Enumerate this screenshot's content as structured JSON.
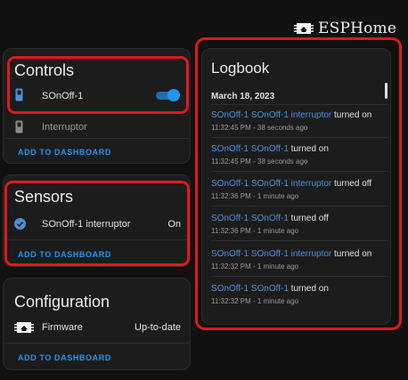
{
  "brand": {
    "name": "ESPHome",
    "icon": "esphome-chip-icon"
  },
  "controls": {
    "title": "Controls",
    "items": [
      {
        "label": "SOnOff-1",
        "icon": "switch-icon",
        "state": "on"
      },
      {
        "label": "Interruptor",
        "icon": "switch-icon"
      }
    ],
    "action": "ADD TO DASHBOARD"
  },
  "sensors": {
    "title": "Sensors",
    "items": [
      {
        "label": "SOnOff-1 interruptor",
        "value": "On",
        "icon": "check-circle-icon"
      }
    ],
    "action": "ADD TO DASHBOARD"
  },
  "configuration": {
    "title": "Configuration",
    "items": [
      {
        "label": "Firmware",
        "value": "Up-to-date",
        "icon": "chip-icon"
      }
    ],
    "action": "ADD TO DASHBOARD"
  },
  "logbook": {
    "title": "Logbook",
    "date": "March 18, 2023",
    "entries": [
      {
        "entity": "SOnOff-1 SOnOff-1 interruptor",
        "action": "turned on",
        "time": "11:32:45 PM - 38 seconds ago"
      },
      {
        "entity": "SOnOff-1 SOnOff-1",
        "action": "turned on",
        "time": "11:32:45 PM - 38 seconds ago"
      },
      {
        "entity": "SOnOff-1 SOnOff-1 interruptor",
        "action": "turned off",
        "time": "11:32:36 PM - 1 minute ago"
      },
      {
        "entity": "SOnOff-1 SOnOff-1",
        "action": "turned off",
        "time": "11:32:36 PM - 1 minute ago"
      },
      {
        "entity": "SOnOff-1 SOnOff-1 interruptor",
        "action": "turned on",
        "time": "11:32:32 PM - 1 minute ago"
      },
      {
        "entity": "SOnOff-1 SOnOff-1",
        "action": "turned on",
        "time": "11:32:32 PM - 1 minute ago"
      }
    ]
  },
  "colors": {
    "accent": "#2196f3",
    "highlight": "#e0181f",
    "card": "#1c1c1c",
    "background": "#111111"
  }
}
